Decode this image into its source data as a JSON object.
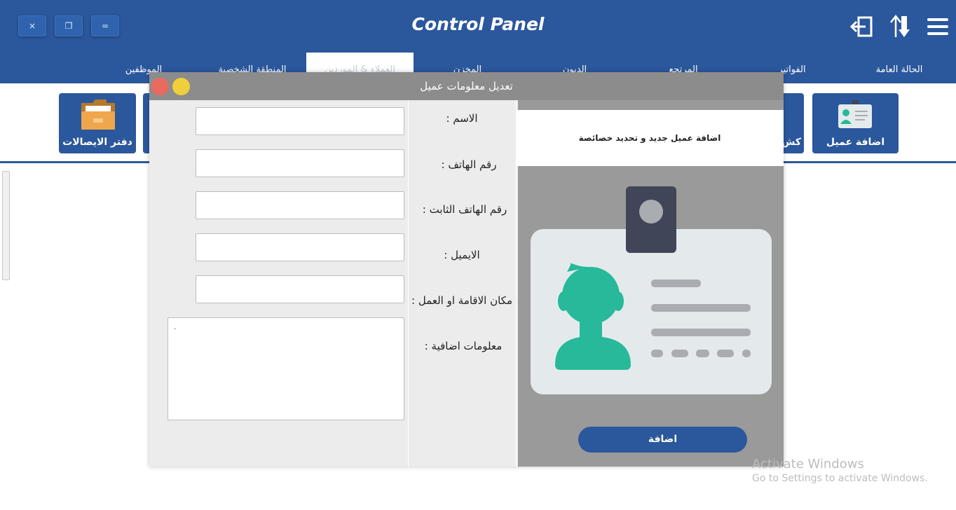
{
  "window_controls": {
    "close": "×",
    "restore": "❐",
    "menu": "="
  },
  "app_title": "Control Panel",
  "tabs": [
    {
      "label": "الحالة العامة"
    },
    {
      "label": "الفواتير"
    },
    {
      "label": "المرتجع"
    },
    {
      "label": "الديون"
    },
    {
      "label": "المخزن"
    },
    {
      "label": "العملاء & الموردين"
    },
    {
      "label": "المنطقة الشخصية"
    },
    {
      "label": "الموظفين"
    }
  ],
  "toolbar": {
    "add_client": "اضافة عميل",
    "statement_partial": "كش",
    "receipts_book": "دفتر الايصالات"
  },
  "modal": {
    "title": "تعديل معلومات عميل",
    "labels": {
      "name": "الاسم :",
      "phone": "رقم الهاتف :",
      "landline": "رقم الهاتف الثابت :",
      "email": "الايميل :",
      "address": "مكان الاقامة او العمل :",
      "extra": "معلومات اضافية :"
    },
    "extra_value": ".",
    "panel_caption": "اضافة عميل جديد و تحديد خصائصة",
    "add_button": "اضافة"
  },
  "watermark": {
    "line1": "Activate Windows",
    "line2": "Go to Settings to activate Windows."
  },
  "colors": {
    "header": "#2b579c",
    "modal_bar": "#8c8c8c",
    "avatar_green": "#27b99a",
    "clip_dark": "#404558"
  },
  "icons": [
    "logout-icon",
    "sort-arrows-icon",
    "hamburger-menu-icon",
    "id-card-icon",
    "folder-icon"
  ]
}
